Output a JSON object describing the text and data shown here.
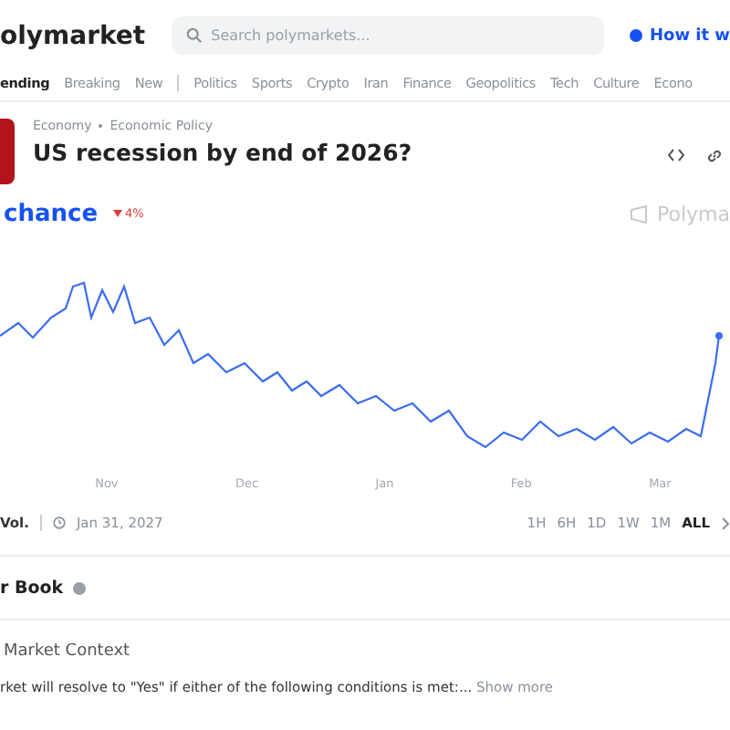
{
  "header": {
    "logo": "olymarket",
    "search": {
      "placeholder": "Search polymarkets..."
    },
    "how_it_works": "How it w"
  },
  "nav": [
    {
      "label": "ending",
      "selected": true
    },
    {
      "label": "Breaking",
      "selected": false
    },
    {
      "label": "New",
      "selected": false
    },
    {
      "label": "Politics",
      "selected": false
    },
    {
      "label": "Sports",
      "selected": false
    },
    {
      "label": "Crypto",
      "selected": false
    },
    {
      "label": "Iran",
      "selected": false
    },
    {
      "label": "Finance",
      "selected": false
    },
    {
      "label": "Geopolitics",
      "selected": false
    },
    {
      "label": "Tech",
      "selected": false
    },
    {
      "label": "Culture",
      "selected": false
    },
    {
      "label": "Econo",
      "selected": false
    }
  ],
  "market": {
    "breadcrumb": [
      "Economy",
      "Economic Policy"
    ],
    "title": "US recession by end of 2026?",
    "chance": "chance",
    "change": "4%",
    "watermark": "Polyma"
  },
  "chart": {
    "months": [
      "Nov",
      "Dec",
      "Jan",
      "Feb",
      "Mar"
    ]
  },
  "footer": {
    "volume": "Vol.",
    "end_date": "Jan 31, 2027",
    "ranges": [
      {
        "label": "1H",
        "selected": false
      },
      {
        "label": "6H",
        "selected": false
      },
      {
        "label": "1D",
        "selected": false
      },
      {
        "label": "1W",
        "selected": false
      },
      {
        "label": "1M",
        "selected": false
      },
      {
        "label": "ALL",
        "selected": true
      }
    ]
  },
  "order_book": {
    "title": "r Book"
  },
  "context": {
    "title": "Market Context",
    "text": "rket will resolve to \"Yes\" if either of the following conditions is met:...",
    "more": "Show more"
  }
}
